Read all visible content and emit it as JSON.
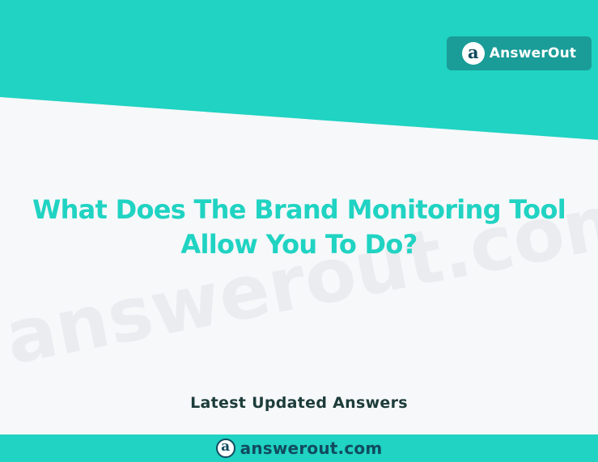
{
  "header": {
    "brand_name": "AnswerOut",
    "logo_glyph": "a",
    "logo_icon": "answerout-logo-icon",
    "band_color": "#20d3c2",
    "pill_color": "#1a9c98"
  },
  "watermark": {
    "text": "answerout.com"
  },
  "main": {
    "headline": "What Does The Brand Monitoring Tool Allow You To Do?",
    "subtitle": "Latest Updated Answers",
    "headline_color": "#20d3c2"
  },
  "footer": {
    "logo_glyph": "a",
    "logo_icon": "answerout-logo-icon",
    "domain": "answerout.com",
    "bar_color": "#20d3c2"
  }
}
